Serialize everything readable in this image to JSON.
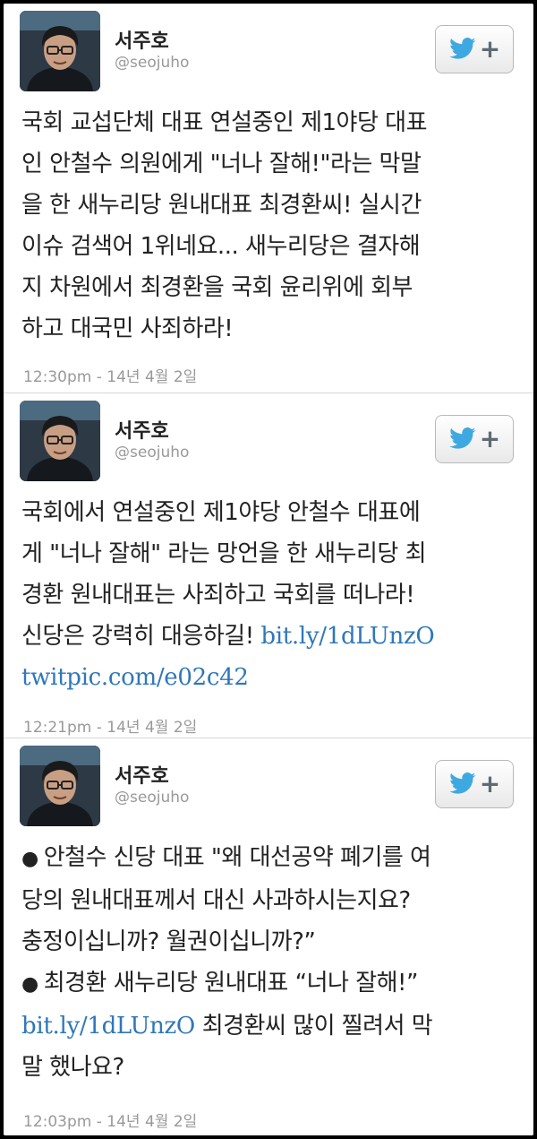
{
  "author": {
    "name": "서주호",
    "handle": "@seojuho"
  },
  "follow_button": {
    "icon": "twitter-bird-icon",
    "plus": "+"
  },
  "colors": {
    "link": "#2f77b8",
    "text": "#222222",
    "meta": "#999999"
  },
  "tweets": [
    {
      "lines": [
        "국회 교섭단체 대표 연설중인 제1야당 대표",
        "인 안철수 의원에게 \"너나 잘해!\"라는 막말",
        "을 한 새누리당 원내대표 최경환씨! 실시간",
        "이슈 검색어 1위네요... 새누리당은 결자해",
        "지 차원에서 최경환을 국회 윤리위에 회부",
        "하고 대국민 사죄하라!"
      ],
      "timestamp": "12:30pm - 14년 4월 2일"
    },
    {
      "lines": [
        "국회에서 연설중인 제1야당 안철수 대표에",
        "게 \"너나 잘해\" 라는 망언을 한 새누리당 최",
        "경환 원내대표는 사죄하고 국회를 떠나라!",
        "신당은 강력히 대응하길!"
      ],
      "link1": "bit.ly/1dLUnzO",
      "link2": "twitpic.com/e02c42",
      "timestamp": "12:21pm - 14년 4월 2일"
    },
    {
      "bullet": "●",
      "line1": "안철수 신당 대표 \"왜 대선공약 폐기를 여",
      "line2": "당의 원내대표께서 대신 사과하시는지요?",
      "line3": "충정이십니까? 월권이십니까?”",
      "line4": "최경환 새누리당 원내대표 “너나 잘해!”",
      "link": "bit.ly/1dLUnzO",
      "line5_rest": " 최경환씨 많이 찔려서 막",
      "line6": "말 했나요?",
      "timestamp": "12:03pm - 14년 4월 2일"
    }
  ]
}
